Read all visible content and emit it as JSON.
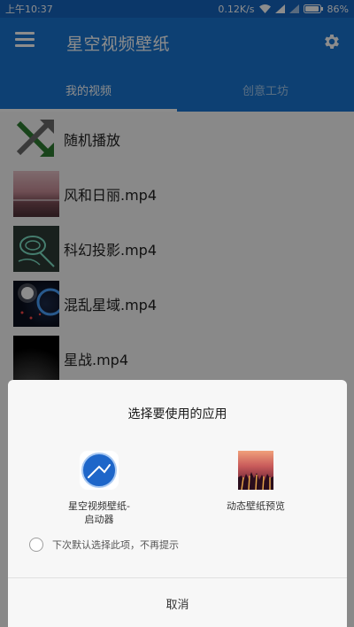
{
  "status_bar": {
    "time": "上午10:37",
    "network_speed": "0.12K/s",
    "battery": "86%"
  },
  "app_bar": {
    "title": "星空视频壁纸"
  },
  "tabs": [
    {
      "label": "我的视频"
    },
    {
      "label": "创意工坊"
    }
  ],
  "video_list": [
    {
      "label": "随机播放",
      "icon": "shuffle-icon"
    },
    {
      "label": "风和日丽.mp4"
    },
    {
      "label": "科幻投影.mp4"
    },
    {
      "label": "混乱星域.mp4"
    },
    {
      "label": "星战.mp4"
    }
  ],
  "chooser": {
    "title": "选择要使用的应用",
    "apps": [
      {
        "name_line1": "星空视频壁纸-",
        "name_line2": "启动器"
      },
      {
        "name_line1": "动态壁纸预览",
        "name_line2": ""
      }
    ],
    "remember_text": "下次默认选择此项，不再提示",
    "cancel_label": "取消"
  },
  "colors": {
    "primary": "#1976d2",
    "status_bar": "#1565c0",
    "shuffle_grey": "#6b6b6b",
    "shuffle_green": "#2e7d32"
  }
}
